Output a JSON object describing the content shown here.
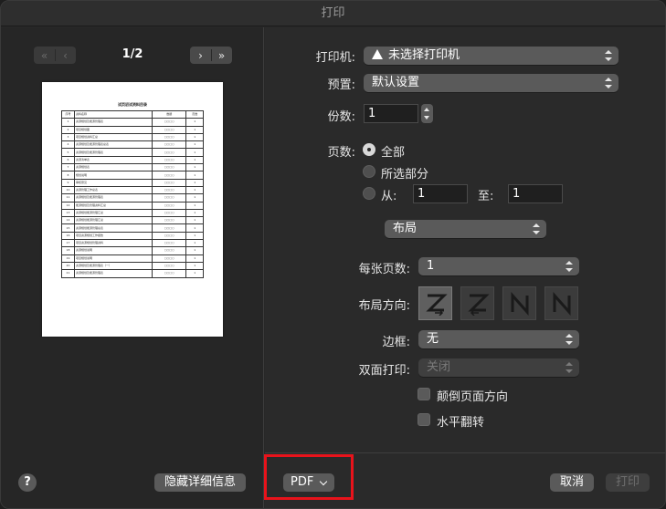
{
  "window": {
    "title": "打印"
  },
  "preview_nav": {
    "first_icon": "double-chevron-left-icon",
    "prev_icon": "chevron-left-icon",
    "next_icon": "chevron-right-icon",
    "last_icon": "double-chevron-right-icon",
    "page_indicator": "1/2"
  },
  "preview": {
    "title": "试页初试资料目录",
    "header": [
      "序号",
      "资料名称",
      "数据",
      "页数"
    ],
    "rows": [
      [
        "1",
        "资源规划及能源管理表",
        "□○□○",
        "1"
      ],
      [
        "2",
        "项目规划图",
        "□○□○",
        "1"
      ],
      [
        "3",
        "项目规划资料汇总",
        "□○□○",
        "1"
      ],
      [
        "4",
        "资源规划及能源管理表总表",
        "□○□○",
        "1"
      ],
      [
        "5",
        "资源规划及能源管理表",
        "□○□○",
        "1"
      ],
      [
        "6",
        "资源清单表",
        "□○□○",
        "1"
      ],
      [
        "7",
        "资源规划表",
        "□○□○",
        "1"
      ],
      [
        "8",
        "规划说明",
        "□○□○",
        "1"
      ],
      [
        "9",
        "审核意见",
        "□○□○",
        "1"
      ],
      [
        "10",
        "资源管理工作总表",
        "□○□○",
        "1"
      ],
      [
        "11",
        "资源规划及能源管理表",
        "□○□○",
        "1"
      ],
      [
        "12",
        "能源规划及管理资料汇总",
        "□○□○",
        "1"
      ],
      [
        "13",
        "资源规划能源管理汇总",
        "□○□○",
        "1"
      ],
      [
        "14",
        "资源规划能源管理汇总",
        "□○□○",
        "1"
      ],
      [
        "15",
        "资源规划能源管理总表",
        "□○□○",
        "1"
      ],
      [
        "16",
        "项目资源规划工作报告",
        "□○□○",
        "1"
      ],
      [
        "17",
        "项目资源规划管理资料",
        "□○□○",
        "1"
      ],
      [
        "18",
        "资源规划说明",
        "□○□○",
        "1"
      ],
      [
        "19",
        "项目规划说明",
        "□○□○",
        "1"
      ],
      [
        "20",
        "资源规划及能源管理表（一）",
        "□○□○",
        "1"
      ],
      [
        "21",
        "资源规划及能源管理表",
        "□○□○",
        "1"
      ]
    ]
  },
  "form": {
    "printer_label": "打印机:",
    "printer_value": "未选择打印机",
    "printer_icon": "warning-icon",
    "preset_label": "预置:",
    "preset_value": "默认设置",
    "copies_label": "份数:",
    "copies_value": "1",
    "pages_label": "页数:",
    "pages_all": "全部",
    "pages_selection": "所选部分",
    "pages_from": "从:",
    "pages_from_value": "1",
    "pages_to": "至:",
    "pages_to_value": "1",
    "pages_selected": "all",
    "section_value": "布局",
    "pages_per_sheet_label": "每张页数:",
    "pages_per_sheet_value": "1",
    "layout_direction_label": "布局方向:",
    "layout_direction_icons": [
      "z-direction-icon",
      "reverse-z-direction-icon",
      "n-reverse-direction-icon",
      "n-direction-icon"
    ],
    "border_label": "边框:",
    "border_value": "无",
    "duplex_label": "双面打印:",
    "duplex_value": "关闭",
    "reverse_orientation": "颠倒页面方向",
    "flip_horizontal": "水平翻转"
  },
  "footer": {
    "help": "?",
    "hide_details": "隐藏详细信息",
    "pdf": "PDF",
    "cancel": "取消",
    "print": "打印"
  },
  "colors": {
    "window_bg": "#282828",
    "highlight": "#e8131b"
  }
}
